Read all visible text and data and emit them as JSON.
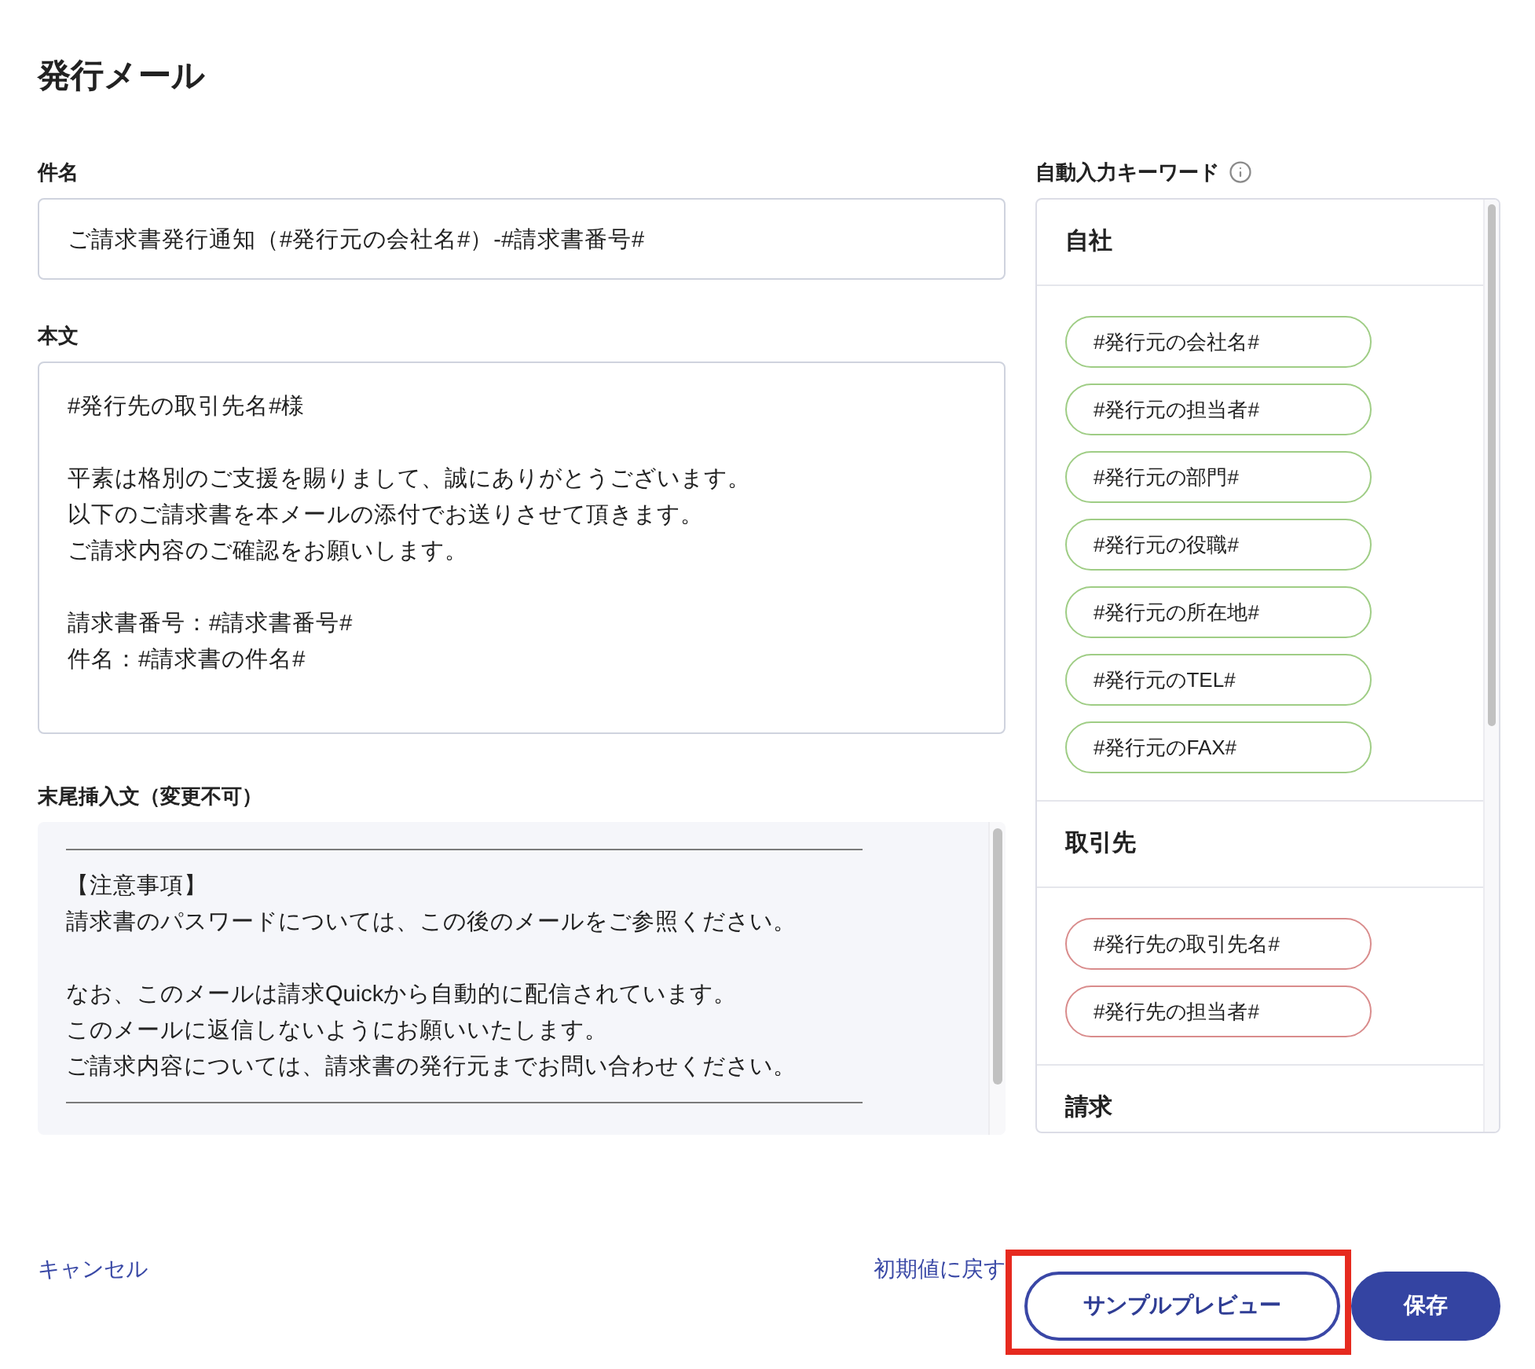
{
  "title": "発行メール",
  "subject": {
    "label": "件名",
    "value": "ご請求書発行通知（#発行元の会社名#）-#請求書番号#"
  },
  "body": {
    "label": "本文",
    "paragraphs": [
      [
        "#発行先の取引先名#様"
      ],
      [
        "平素は格別のご支援を賜りまして、誠にありがとうございます。",
        "以下のご請求書を本メールの添付でお送りさせて頂きます。",
        "ご請求内容のご確認をお願いします。"
      ],
      [
        "請求書番号：#請求書番号#",
        "件名：#請求書の件名#"
      ]
    ]
  },
  "appended_text": {
    "label": "末尾挿入文（変更不可）",
    "blocks": [
      {
        "kind": "rule"
      },
      {
        "kind": "paragraph",
        "lines": [
          "【注意事項】",
          "請求書のパスワードについては、この後のメールをご参照ください。"
        ]
      },
      {
        "kind": "paragraph",
        "lines": [
          "なお、このメールは請求Quickから自動的に配信されています。",
          "このメールに返信しないようにお願いいたします。",
          "ご請求内容については、請求書の発行元までお問い合わせください。"
        ]
      },
      {
        "kind": "rule"
      }
    ]
  },
  "keywords": {
    "label": "自動入力キーワード",
    "sections": [
      {
        "title": "自社",
        "color": "#9fcd85",
        "chips": [
          "#発行元の会社名#",
          "#発行元の担当者#",
          "#発行元の部門#",
          "#発行元の役職#",
          "#発行元の所在地#",
          "#発行元のTEL#",
          "#発行元のFAX#"
        ]
      },
      {
        "title": "取引先",
        "color": "#d98c8c",
        "chips": [
          "#発行先の取引先名#",
          "#発行先の担当者#"
        ]
      },
      {
        "title": "請求"
      }
    ]
  },
  "actions": {
    "cancel": "キャンセル",
    "reset": "初期値に戻す",
    "buttons": [
      {
        "label": "サンプルプレビュー",
        "kind": "outline",
        "highlighted": true
      },
      {
        "label": "保存",
        "kind": "primary",
        "highlighted": false
      }
    ]
  }
}
